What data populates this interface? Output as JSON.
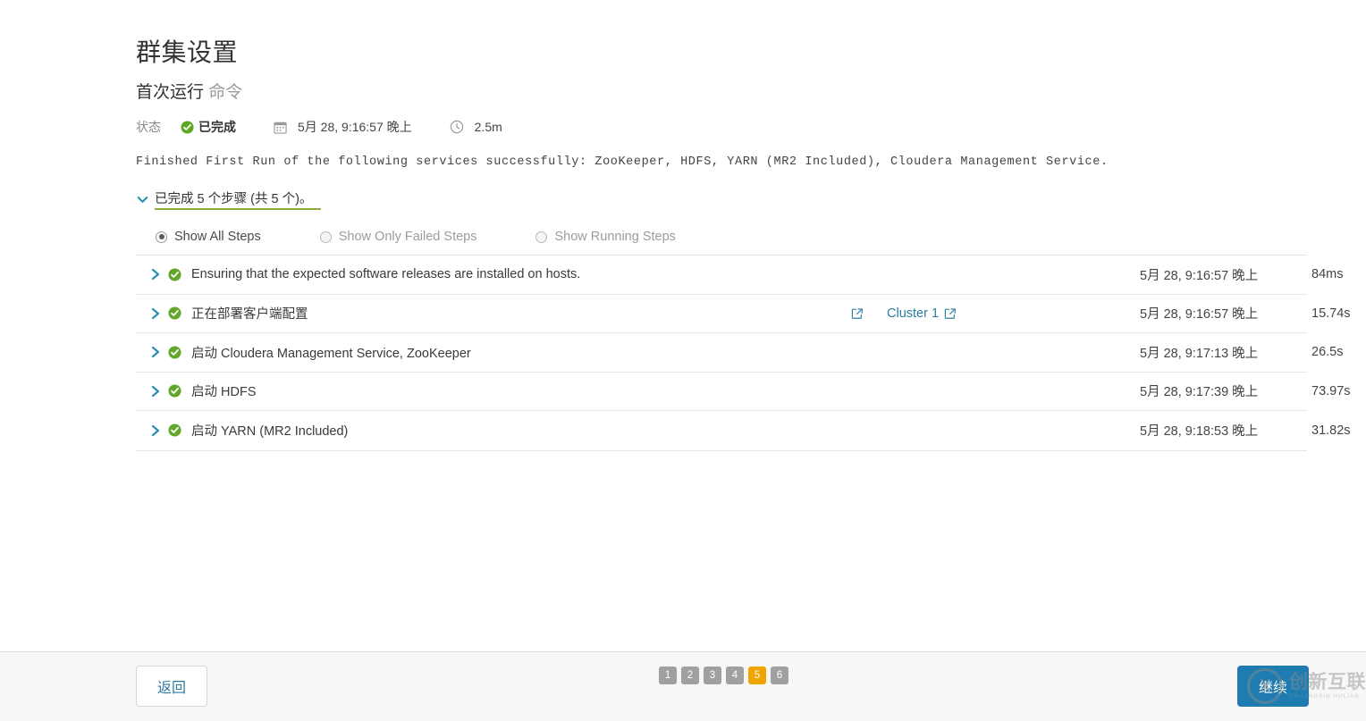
{
  "header": {
    "title": "群集设置",
    "subtitle_main": "首次运行",
    "subtitle_muted": "命令"
  },
  "status": {
    "label": "状态",
    "value": "已完成",
    "check_icon": "check-circle-icon",
    "calendar_icon": "calendar-icon",
    "timestamp": "5月 28, 9:16:57 晚上",
    "clock_icon": "clock-icon",
    "duration": "2.5m"
  },
  "description": "Finished First Run of the following services successfully: ZooKeeper, HDFS, YARN (MR2 Included), Cloudera Management Service.",
  "steps_toggle": {
    "icon": "chevron-down-icon",
    "text": "已完成 5 个步骤 (共 5 个)。",
    "underline_color": "#8aad3e"
  },
  "filters": [
    {
      "label": "Show All Steps",
      "selected": true
    },
    {
      "label": "Show Only Failed Steps",
      "selected": false
    },
    {
      "label": "Show Running Steps",
      "selected": false
    }
  ],
  "steps": [
    {
      "name": "Ensuring that the expected software releases are installed on hosts.",
      "status_icon": "success-check-icon",
      "expand_icon": "chevron-right-icon",
      "link_label": "",
      "has_links": false,
      "time": "5月 28, 9:16:57 晚上",
      "duration": "84ms"
    },
    {
      "name": "正在部署客户端配置",
      "status_icon": "success-check-icon",
      "expand_icon": "chevron-right-icon",
      "link_label": "Cluster 1",
      "has_links": true,
      "time": "5月 28, 9:16:57 晚上",
      "duration": "15.74s"
    },
    {
      "name": "启动 Cloudera Management Service, ZooKeeper",
      "status_icon": "success-check-icon",
      "expand_icon": "chevron-right-icon",
      "link_label": "",
      "has_links": false,
      "time": "5月 28, 9:17:13 晚上",
      "duration": "26.5s"
    },
    {
      "name": "启动 HDFS",
      "status_icon": "success-check-icon",
      "expand_icon": "chevron-right-icon",
      "link_label": "",
      "has_links": false,
      "time": "5月 28, 9:17:39 晚上",
      "duration": "73.97s"
    },
    {
      "name": "启动 YARN (MR2 Included)",
      "status_icon": "success-check-icon",
      "expand_icon": "chevron-right-icon",
      "link_label": "",
      "has_links": false,
      "time": "5月 28, 9:18:53 晚上",
      "duration": "31.82s"
    }
  ],
  "footer": {
    "back_label": "返回",
    "continue_label": "继续",
    "pagination": [
      {
        "label": "1",
        "active": false
      },
      {
        "label": "2",
        "active": false
      },
      {
        "label": "3",
        "active": false
      },
      {
        "label": "4",
        "active": false
      },
      {
        "label": "5",
        "active": true
      },
      {
        "label": "6",
        "active": false
      }
    ],
    "accent_color": "#1e7cb0",
    "active_page_color": "#f0a400"
  },
  "watermark": {
    "mark": "X",
    "cn_text": "创新互联",
    "en_text": "CHUANGXIN HULIAN"
  }
}
